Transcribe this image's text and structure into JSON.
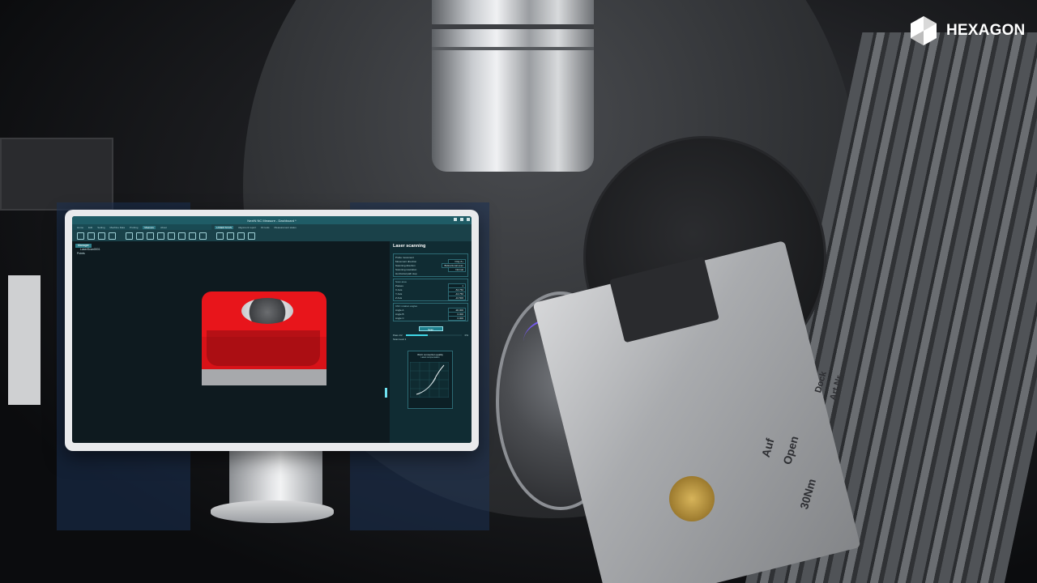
{
  "brand": {
    "logo_text": "HEXAGON"
  },
  "engravings": {
    "auf": "Auf",
    "open": "Open",
    "torque": "30Nm",
    "dock": "Dock",
    "ref": "Art.Nr."
  },
  "app": {
    "title": "NextN NC Measure - Dashboard *",
    "menu": [
      "Home",
      "Edit",
      "Setting",
      "Machine Data",
      "Probing",
      "Measure",
      "About"
    ],
    "menu_active_index": 5,
    "menu_right": [
      "LASER SCAN",
      "Alignment report",
      "Fit tools",
      "Measurement status"
    ],
    "tree": [
      "Manager",
      "LaserScan0001",
      "Points"
    ],
    "panel": {
      "title": "Laser scanning",
      "settings": [
        {
          "label": "Probe movement",
          "value": ""
        },
        {
          "label": "Movement direction",
          "value": "Only Z+"
        },
        {
          "label": "Scanning direction",
          "value": "Bidirectional scan"
        },
        {
          "label": "Scanning resolution",
          "value": "Normal"
        },
        {
          "label": "Horizontal path step",
          "value": ""
        }
      ],
      "scan_area_label": "Scan area",
      "scan_area": [
        {
          "label": "Passes",
          "value": "1"
        },
        {
          "label": "X Axis",
          "value": "-54.750"
        },
        {
          "label": "Y Axis",
          "value": "-44.750"
        },
        {
          "label": "Z Axis",
          "value": "-10.500"
        }
      ],
      "cnc_label": "CNC rotation angles",
      "cnc": [
        {
          "label": "Angle A",
          "value": "-90.000"
        },
        {
          "label": "Angle B",
          "value": "0.000"
        },
        {
          "label": "Angle C",
          "value": "0.000"
        }
      ],
      "scan_button": "Scan",
      "progress_label": "Pass 1/2",
      "progress_percent": 40,
      "progress_text": "0%",
      "scan_level_label": "Scan level 1",
      "wifi_title": "Wi-Fi connection quality",
      "wifi_sub": "Latest compensation"
    }
  },
  "colors": {
    "accent": "#1f5c66",
    "part_red": "#e8151b",
    "panel_bg": "#102c33"
  }
}
